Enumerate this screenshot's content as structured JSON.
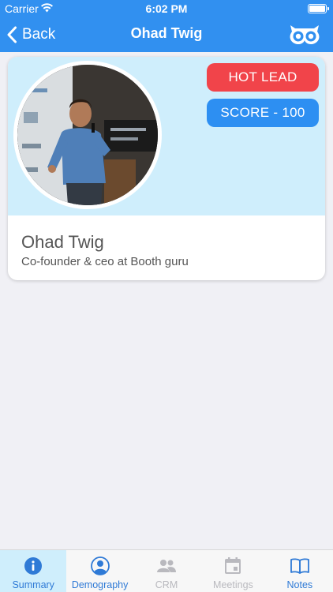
{
  "status_bar": {
    "carrier": "Carrier",
    "time": "6:02 PM"
  },
  "nav": {
    "back_label": "Back",
    "title": "Ohad Twig"
  },
  "profile": {
    "badge": "HOT LEAD",
    "score": "SCORE - 100",
    "name": "Ohad Twig",
    "subtitle": "Co-founder & ceo at Booth guru"
  },
  "tabs": [
    {
      "label": "Summary",
      "icon": "info-icon",
      "state": "active"
    },
    {
      "label": "Demography",
      "icon": "person-icon",
      "state": "enabled"
    },
    {
      "label": "CRM",
      "icon": "people-icon",
      "state": "disabled"
    },
    {
      "label": "Meetings",
      "icon": "calendar-icon",
      "state": "disabled"
    },
    {
      "label": "Notes",
      "icon": "book-icon",
      "state": "enabled"
    }
  ],
  "colors": {
    "nav_bar": "#3190f0",
    "hero_bg": "#cfeefc",
    "hot_lead": "#f1444a",
    "score": "#2d8ff2",
    "tab_active": "#2f7ad6",
    "tab_disabled": "#b9b9be"
  }
}
